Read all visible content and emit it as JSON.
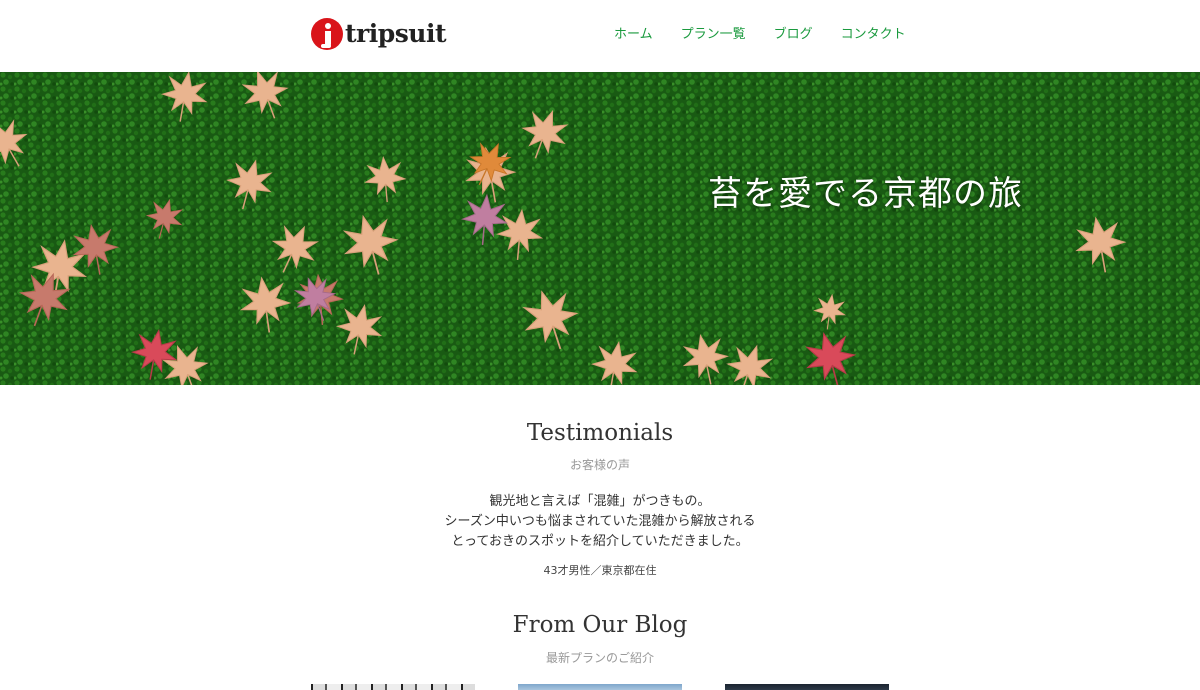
{
  "header": {
    "logo_text": "tripsuit",
    "nav": [
      {
        "label": "ホーム"
      },
      {
        "label": "プラン一覧"
      },
      {
        "label": "ブログ"
      },
      {
        "label": "コンタクト"
      }
    ]
  },
  "hero": {
    "title": "苔を愛でる京都の旅"
  },
  "testimonials": {
    "title": "Testimonials",
    "subtitle": "お客様の声",
    "quote_lines": [
      "観光地と言えば「混雑」がつきもの。",
      "シーズン中いつも悩まされていた混雑から解放される",
      "とっておきのスポットを紹介していただきました。"
    ],
    "author": "43才男性／東京都在住"
  },
  "blog": {
    "title": "From Our Blog",
    "subtitle": "最新プランのご紹介"
  },
  "colors": {
    "nav_link": "#1a9a3e",
    "logo_red": "#d9141a",
    "moss_green": "#1c5e15"
  }
}
